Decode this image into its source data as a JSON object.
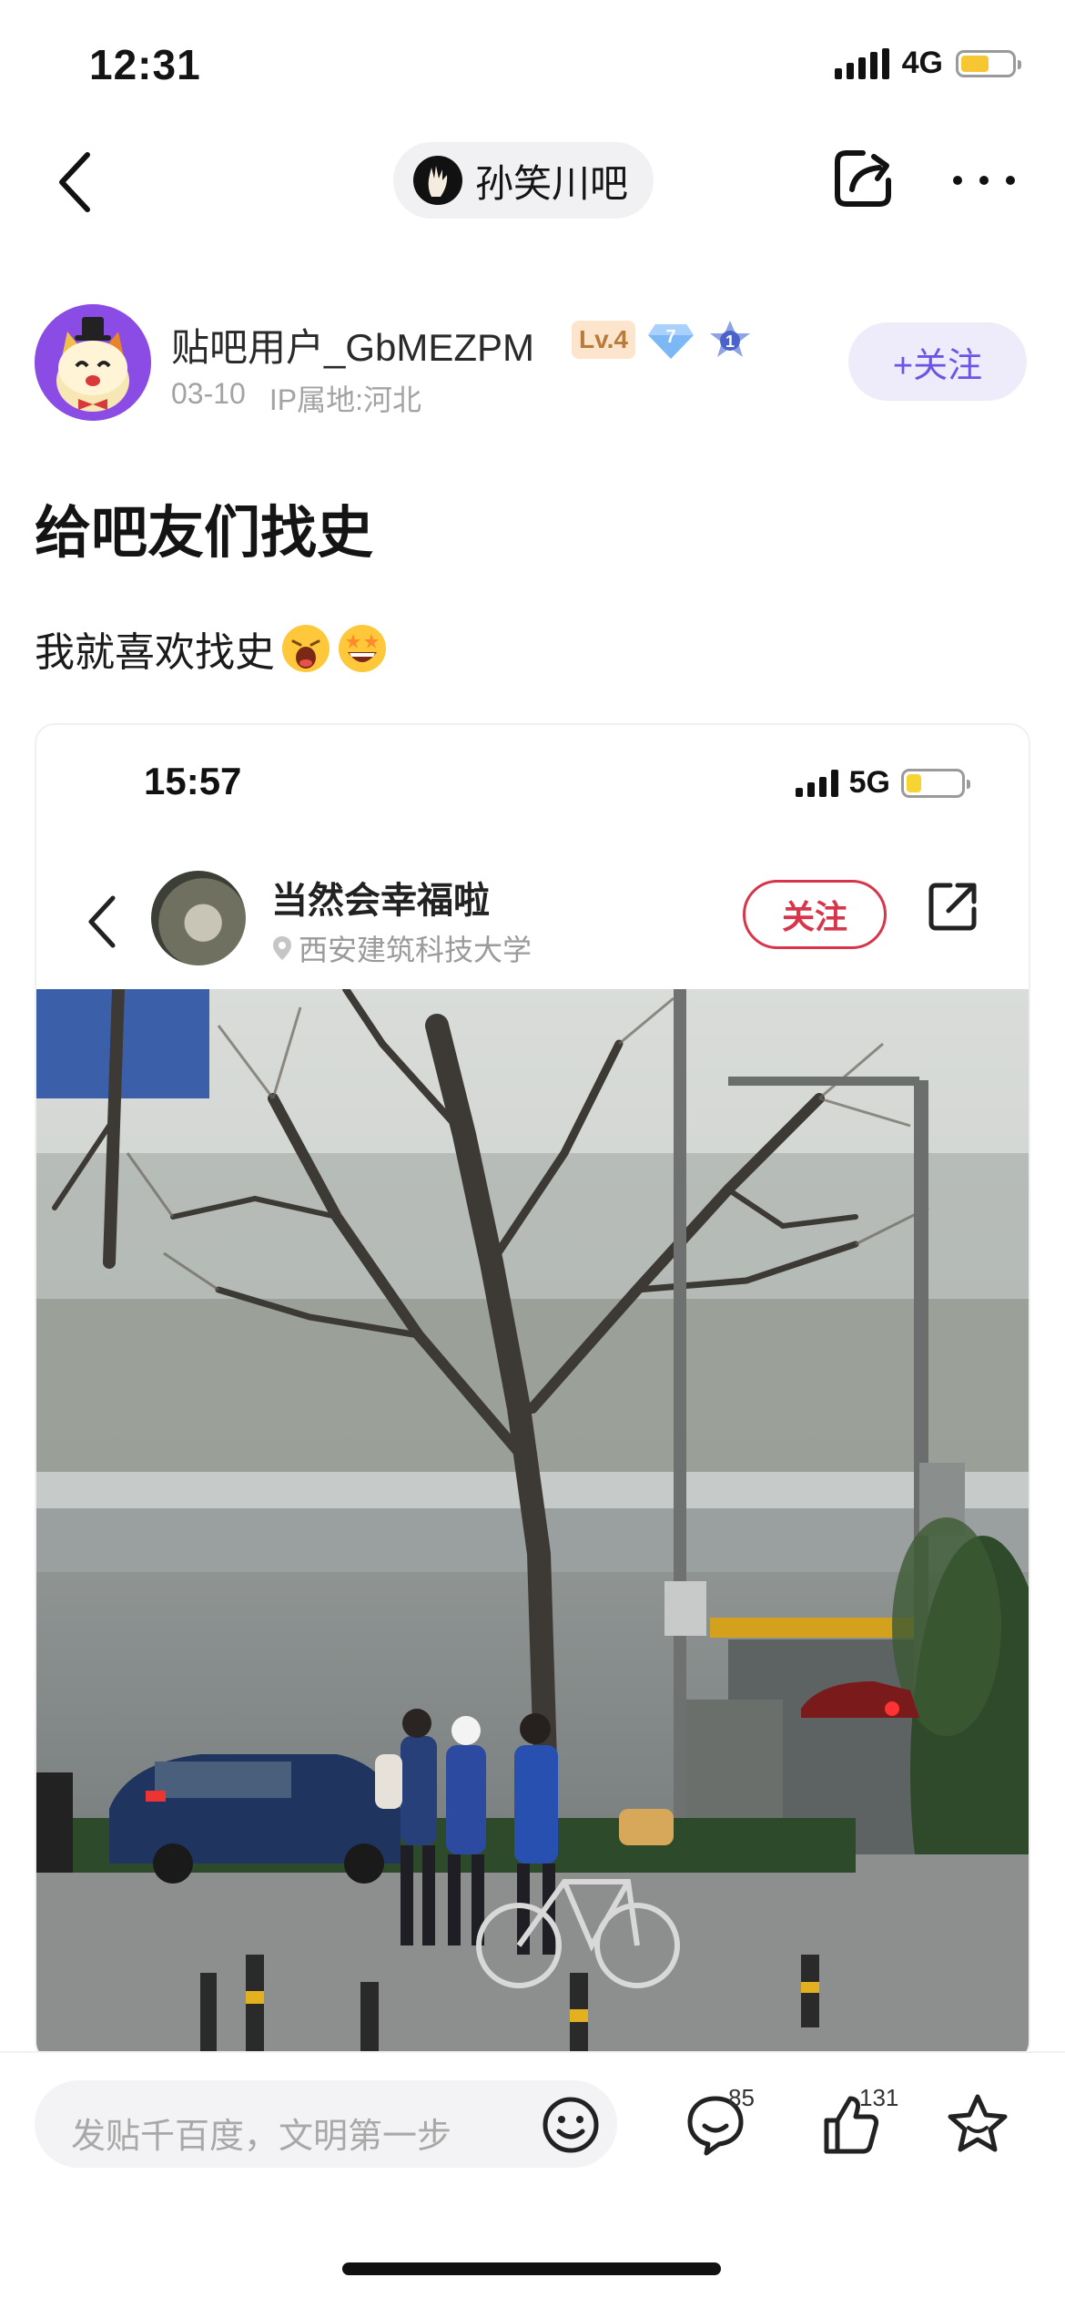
{
  "status_bar": {
    "time": "12:31",
    "network": "4G"
  },
  "nav": {
    "forum_name": "孙笑川吧",
    "back_icon": "chevron-left-icon",
    "share_icon": "share-icon",
    "more_icon": "more-dots-icon"
  },
  "author": {
    "name": "贴吧用户_GbMEZPM",
    "level": "Lv.4",
    "gem_level": "7",
    "medal_level": "1",
    "date": "03-10",
    "ip_location": "IP属地:河北",
    "follow_label": "+关注"
  },
  "post": {
    "title": "给吧友们找史",
    "body": "我就喜欢找史",
    "emojis": [
      "shocked-face-emoji",
      "grinning-star-eyes-emoji"
    ]
  },
  "embedded_screenshot": {
    "time": "15:57",
    "network": "5G",
    "user_name": "当然会幸福啦",
    "location": "西安建筑科技大学",
    "follow_label": "关注",
    "photo": "street-scene-students-with-bicycle"
  },
  "bottom_bar": {
    "input_placeholder": "发贴千百度，文明第一步",
    "comment_count": "85",
    "like_count": "131",
    "icons": [
      "emoji-icon",
      "comment-icon",
      "like-icon",
      "favorite-star-icon"
    ]
  },
  "colors": {
    "accent": "#6b55e6",
    "follow_red": "#d9354a",
    "avatar_purple": "#8b4ce6"
  }
}
